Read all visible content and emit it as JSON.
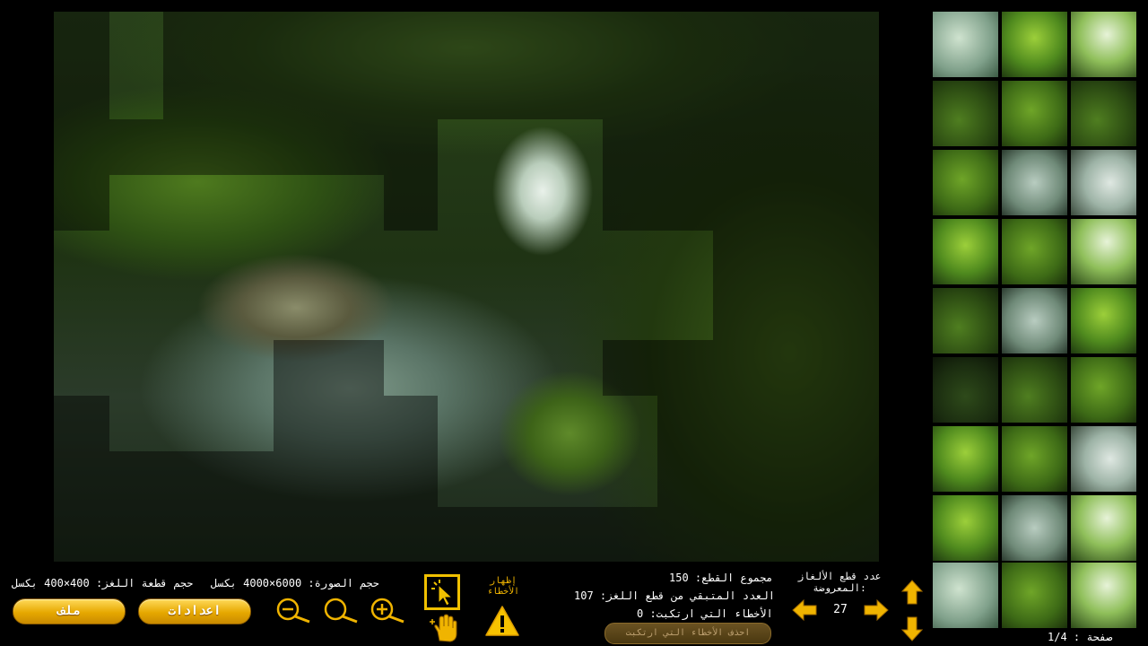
{
  "puzzle": {
    "image_size_label": "حجم الصورة: 6000×4000 بكسل",
    "piece_size_label": "حجم قطعة اللغز: 400×400 بكسل",
    "total_pieces_label": "مجموع القطع: 150",
    "remaining_label": "العدد المتبقي من قطع اللغز: 107",
    "errors_label": "الأخطاء التي ارتكبت: 0",
    "show_errors_label": "إظهار الأخطاء",
    "delete_errors_label": "احذف الأخطاء التي ارتكبت",
    "pieces_shown_label": "عدد قطع الألغاز المعروضة:",
    "pieces_shown_value": "27",
    "page_label": "صفحة : 1/4"
  },
  "buttons": {
    "file_label": "ملف",
    "settings_label": "اعدادات"
  },
  "icons": {
    "zoom_out": "zoom-out-icon",
    "zoom_reset": "zoom-reset-icon",
    "zoom_in": "zoom-in-icon",
    "select": "select-cursor-icon",
    "hand": "hand-icon",
    "warning": "warning-icon",
    "left": "arrow-left-icon",
    "right": "arrow-right-icon",
    "up": "arrow-up-icon",
    "down": "arrow-down-icon"
  },
  "colors": {
    "accent": "#f0b400",
    "select_border": "#f0c000"
  }
}
